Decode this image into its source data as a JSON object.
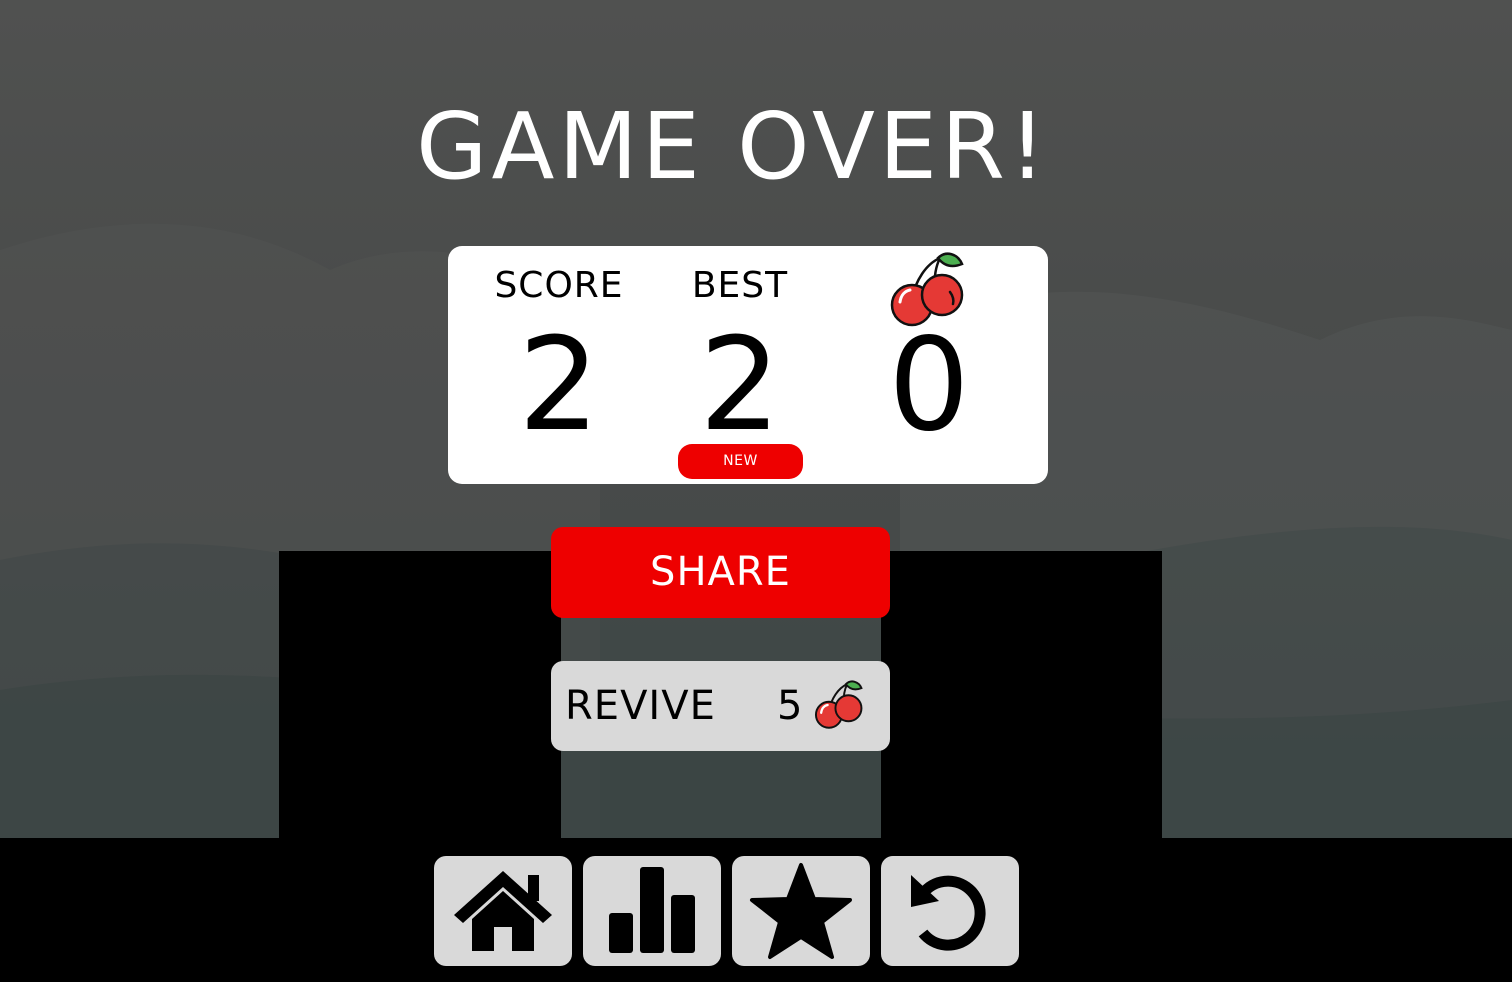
{
  "title": "GAME OVER!",
  "scoreboard": {
    "score_label": "SCORE",
    "score_value": "2",
    "best_label": "BEST",
    "best_value": "2",
    "new_badge": "NEW",
    "cherries_icon": "cherry-icon",
    "cherries_value": "0"
  },
  "actions": {
    "share_label": "SHARE",
    "revive_label": "REVIVE",
    "revive_cost": "5",
    "revive_cost_icon": "cherry-icon"
  },
  "nav": [
    {
      "icon": "home-icon"
    },
    {
      "icon": "leaderboard-icon"
    },
    {
      "icon": "star-icon"
    },
    {
      "icon": "restart-icon"
    }
  ],
  "colors": {
    "accent": "#ee0000",
    "card": "#ffffff",
    "button_gray": "#d9d9d9",
    "silhouette": "#000000"
  }
}
